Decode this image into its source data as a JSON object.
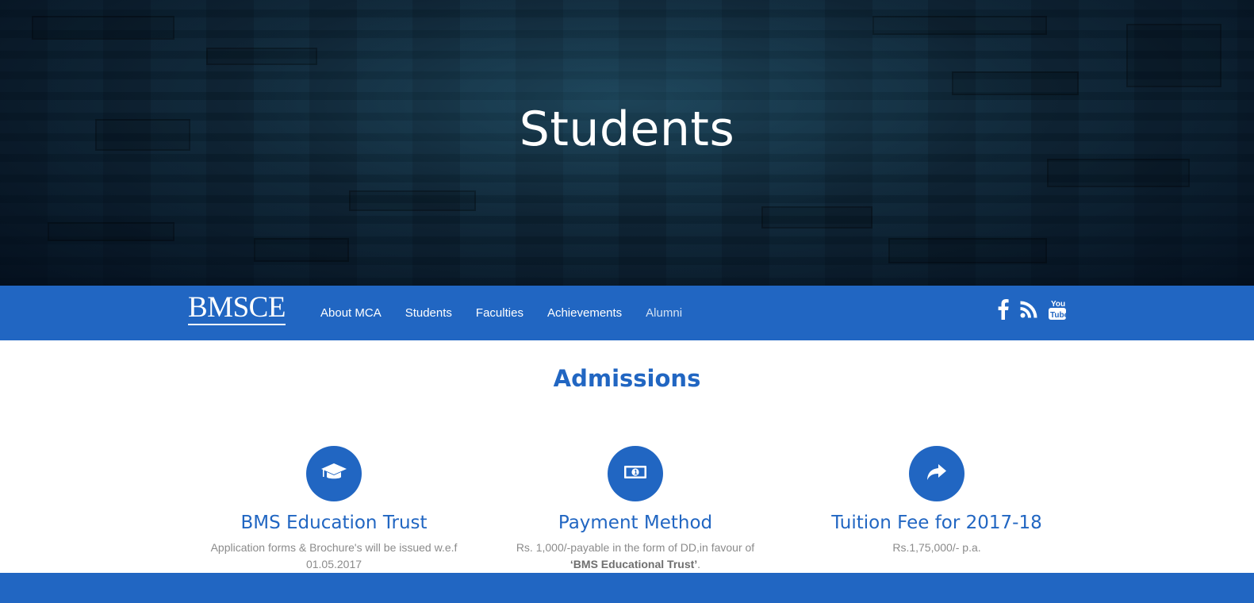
{
  "hero": {
    "title": "Students"
  },
  "navbar": {
    "brand": "BMSCE",
    "links": [
      {
        "label": "About MCA"
      },
      {
        "label": "Students"
      },
      {
        "label": "Faculties"
      },
      {
        "label": "Achievements"
      },
      {
        "label": "Alumni"
      }
    ],
    "social_icons": [
      "facebook-icon",
      "rss-icon",
      "youtube-icon"
    ]
  },
  "section": {
    "title": "Admissions"
  },
  "features": [
    {
      "icon": "graduation-cap-icon",
      "title": "BMS Education Trust",
      "text_line1": "Application forms & Brochure's will be issued w.e.f",
      "text_line2": "01.05.2017"
    },
    {
      "icon": "money-icon",
      "title": "Payment Method",
      "text_line1": "Rs. 1,000/-payable in the form of DD,in favour of",
      "text_bold": "‘BMS Educational Trust’",
      "text_end": "."
    },
    {
      "icon": "share-arrow-icon",
      "title": "Tuition Fee for 2017-18",
      "text_line1": "Rs.1,75,000/- p.a."
    }
  ],
  "colors": {
    "primary": "#2166c2",
    "text_muted": "#8b8b8b",
    "hero_dark": "#0d2233"
  }
}
